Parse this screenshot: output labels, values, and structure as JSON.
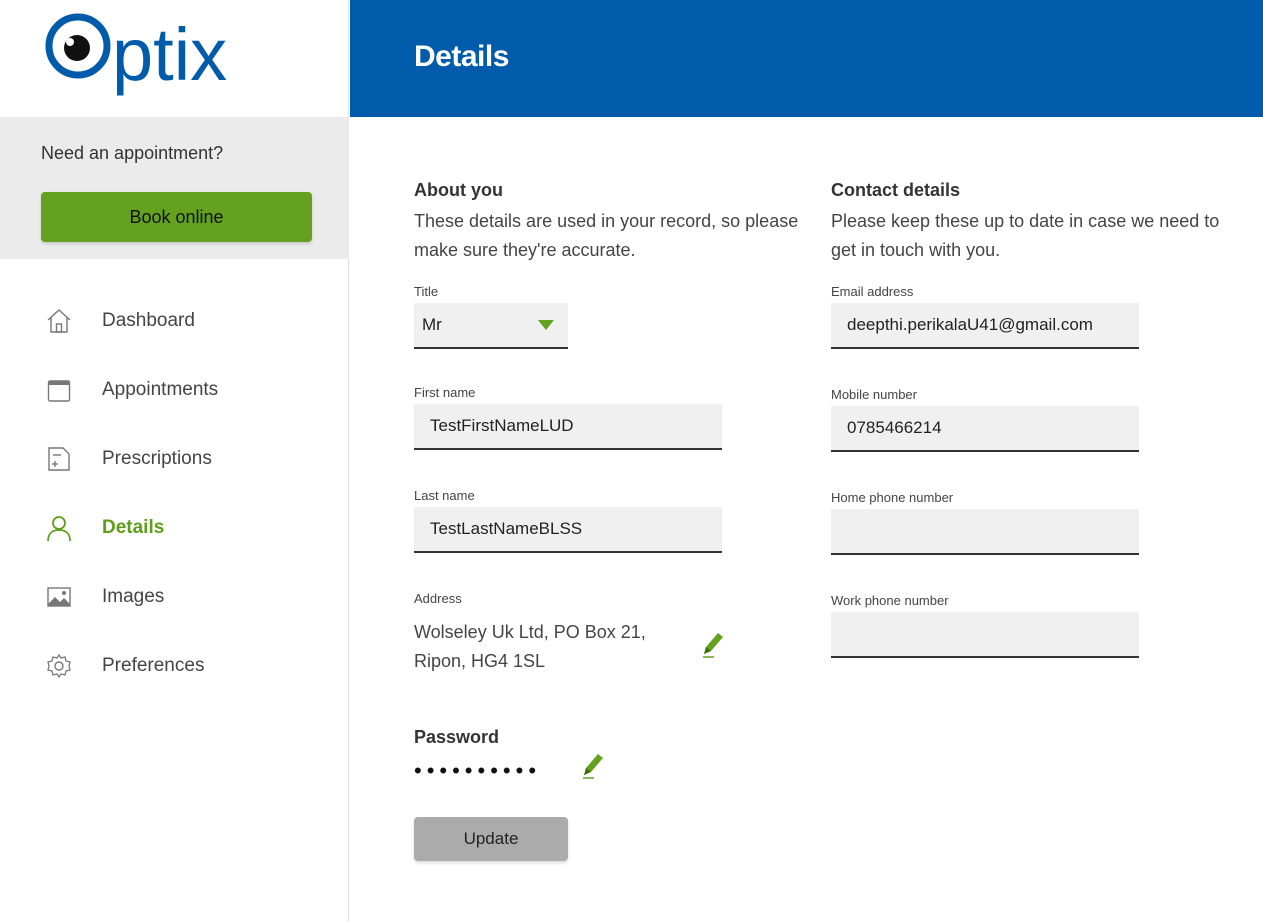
{
  "brand": {
    "logo_text": "Optix",
    "primary_color": "#005bab",
    "accent_color": "#63a11f"
  },
  "sidebar": {
    "appointment_prompt": "Need an appointment?",
    "book_label": "Book online",
    "items": [
      {
        "label": "Dashboard",
        "icon": "home-icon"
      },
      {
        "label": "Appointments",
        "icon": "calendar-icon"
      },
      {
        "label": "Prescriptions",
        "icon": "prescription-icon"
      },
      {
        "label": "Details",
        "icon": "user-icon",
        "active": true
      },
      {
        "label": "Images",
        "icon": "image-icon"
      },
      {
        "label": "Preferences",
        "icon": "gear-icon"
      }
    ]
  },
  "header": {
    "title": "Details"
  },
  "about": {
    "heading": "About you",
    "description": "These details are used in your record, so please make sure they're accurate.",
    "title_label": "Title",
    "title_value": "Mr",
    "first_name_label": "First name",
    "first_name_value": "TestFirstNameLUD",
    "last_name_label": "Last name",
    "last_name_value": "TestLastNameBLSS",
    "address_label": "Address",
    "address_value": "Wolseley Uk Ltd, PO Box 21, Ripon, HG4 1SL"
  },
  "password": {
    "heading": "Password",
    "masked_value": "••••••••••"
  },
  "contact": {
    "heading": "Contact details",
    "description": "Please keep these up to date in case we need to get in touch with you.",
    "email_label": "Email address",
    "email_value": "deepthi.perikalaU41@gmail.com",
    "mobile_label": "Mobile number",
    "mobile_value": "0785466214",
    "home_label": "Home phone number",
    "home_value": "",
    "work_label": "Work phone number",
    "work_value": ""
  },
  "actions": {
    "update_label": "Update"
  }
}
